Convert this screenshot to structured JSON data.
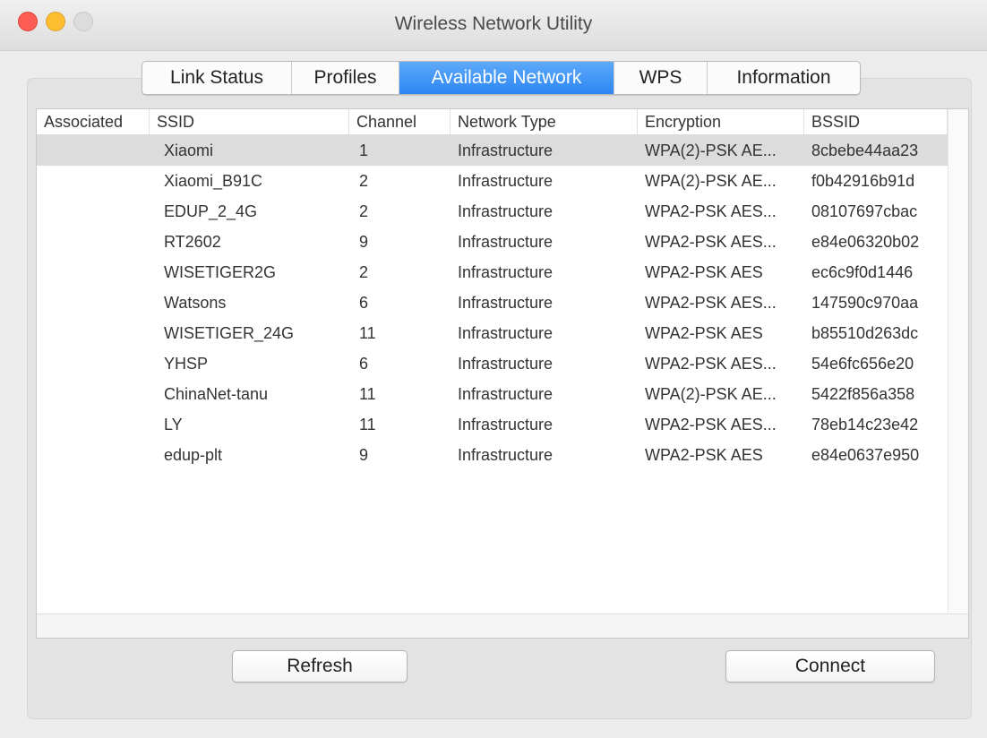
{
  "window": {
    "title": "Wireless Network Utility"
  },
  "tabs": [
    {
      "label": "Link Status",
      "active": false
    },
    {
      "label": "Profiles",
      "active": false
    },
    {
      "label": "Available Network",
      "active": true
    },
    {
      "label": "WPS",
      "active": false
    },
    {
      "label": "Information",
      "active": false
    }
  ],
  "table": {
    "columns": [
      "Associated",
      "SSID",
      "Channel",
      "Network Type",
      "Encryption",
      "BSSID"
    ],
    "selected_row": 0,
    "rows": [
      [
        "",
        "Xiaomi",
        "1",
        "Infrastructure",
        "WPA(2)-PSK AE...",
        "8cbebe44aa23"
      ],
      [
        "",
        "Xiaomi_B91C",
        "2",
        "Infrastructure",
        "WPA(2)-PSK AE...",
        "f0b42916b91d"
      ],
      [
        "",
        "EDUP_2_4G",
        "2",
        "Infrastructure",
        "WPA2-PSK AES...",
        "08107697cbac"
      ],
      [
        "",
        "RT2602",
        "9",
        "Infrastructure",
        "WPA2-PSK AES...",
        "e84e06320b02"
      ],
      [
        "",
        "WISETIGER2G",
        "2",
        "Infrastructure",
        "WPA2-PSK AES",
        "ec6c9f0d1446"
      ],
      [
        "",
        "Watsons",
        "6",
        "Infrastructure",
        "WPA2-PSK AES...",
        "147590c970aa"
      ],
      [
        "",
        "WISETIGER_24G",
        "11",
        "Infrastructure",
        "WPA2-PSK AES",
        "b85510d263dc"
      ],
      [
        "",
        "YHSP",
        "6",
        "Infrastructure",
        "WPA2-PSK AES...",
        "54e6fc656e20"
      ],
      [
        "",
        "ChinaNet-tanu",
        "11",
        "Infrastructure",
        "WPA(2)-PSK AE...",
        "5422f856a358"
      ],
      [
        "",
        "LY",
        "11",
        "Infrastructure",
        "WPA2-PSK AES...",
        "78eb14c23e42"
      ],
      [
        "",
        "edup-plt",
        "9",
        "Infrastructure",
        "WPA2-PSK AES",
        "e84e0637e950"
      ]
    ]
  },
  "buttons": {
    "refresh": "Refresh",
    "connect": "Connect"
  },
  "colors": {
    "accent": "#2c86f4",
    "selected_row": "#dcdcdc",
    "close": "#fd5d55",
    "minimize": "#fdbd2e",
    "maximize_disabled": "#dcdcdc"
  }
}
